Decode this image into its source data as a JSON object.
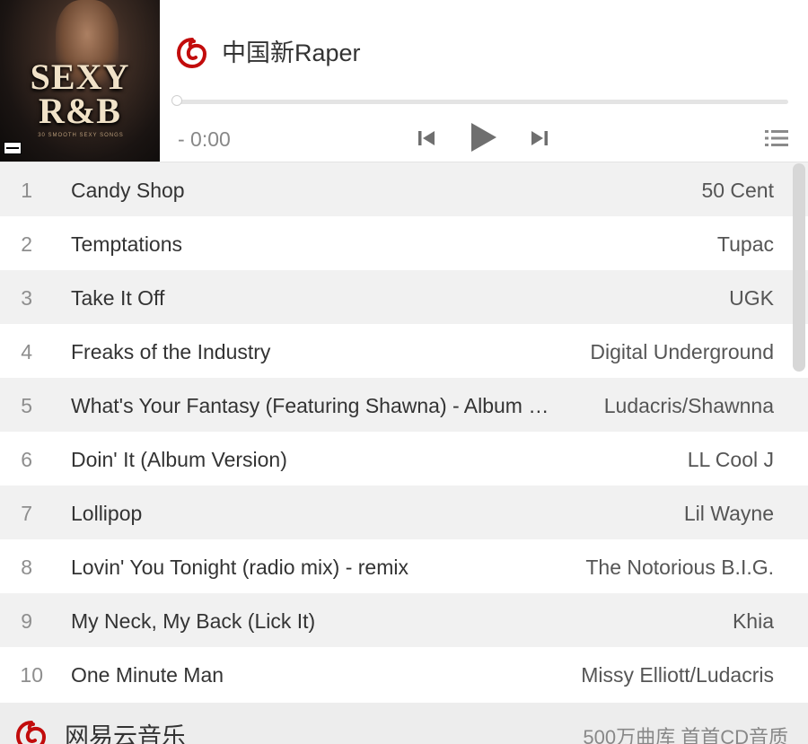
{
  "header": {
    "playlist_title": "中国新Raper",
    "cover": {
      "title_line1": "SEXY",
      "title_line2": "R&B",
      "subtitle": "30 SMOOTH SEXY SONGS"
    },
    "time_display": "- 0:00",
    "progress": 0,
    "brand_color": "#c20c0c"
  },
  "controls": {
    "prev_icon": "skip-previous-icon",
    "play_icon": "play-icon",
    "next_icon": "skip-next-icon",
    "list_icon": "playlist-icon"
  },
  "tracks": [
    {
      "num": "1",
      "title": "Candy Shop",
      "artist": "50 Cent"
    },
    {
      "num": "2",
      "title": "Temptations",
      "artist": "Tupac"
    },
    {
      "num": "3",
      "title": "Take It Off",
      "artist": "UGK"
    },
    {
      "num": "4",
      "title": "Freaks of the Industry",
      "artist": "Digital Underground"
    },
    {
      "num": "5",
      "title": "What's Your Fantasy (Featuring Shawna) - Album Version",
      "artist": "Ludacris/Shawnna"
    },
    {
      "num": "6",
      "title": "Doin' It (Album Version)",
      "artist": "LL Cool J"
    },
    {
      "num": "7",
      "title": "Lollipop",
      "artist": "Lil Wayne"
    },
    {
      "num": "8",
      "title": "Lovin' You Tonight (radio mix) - remix",
      "artist": "The Notorious B.I.G."
    },
    {
      "num": "9",
      "title": "My Neck, My Back (Lick It)",
      "artist": "Khia"
    },
    {
      "num": "10",
      "title": "One Minute Man",
      "artist": "Missy Elliott/Ludacris"
    }
  ],
  "footer": {
    "brand": "网易云音乐",
    "slogan": "500万曲库 首首CD音质"
  }
}
